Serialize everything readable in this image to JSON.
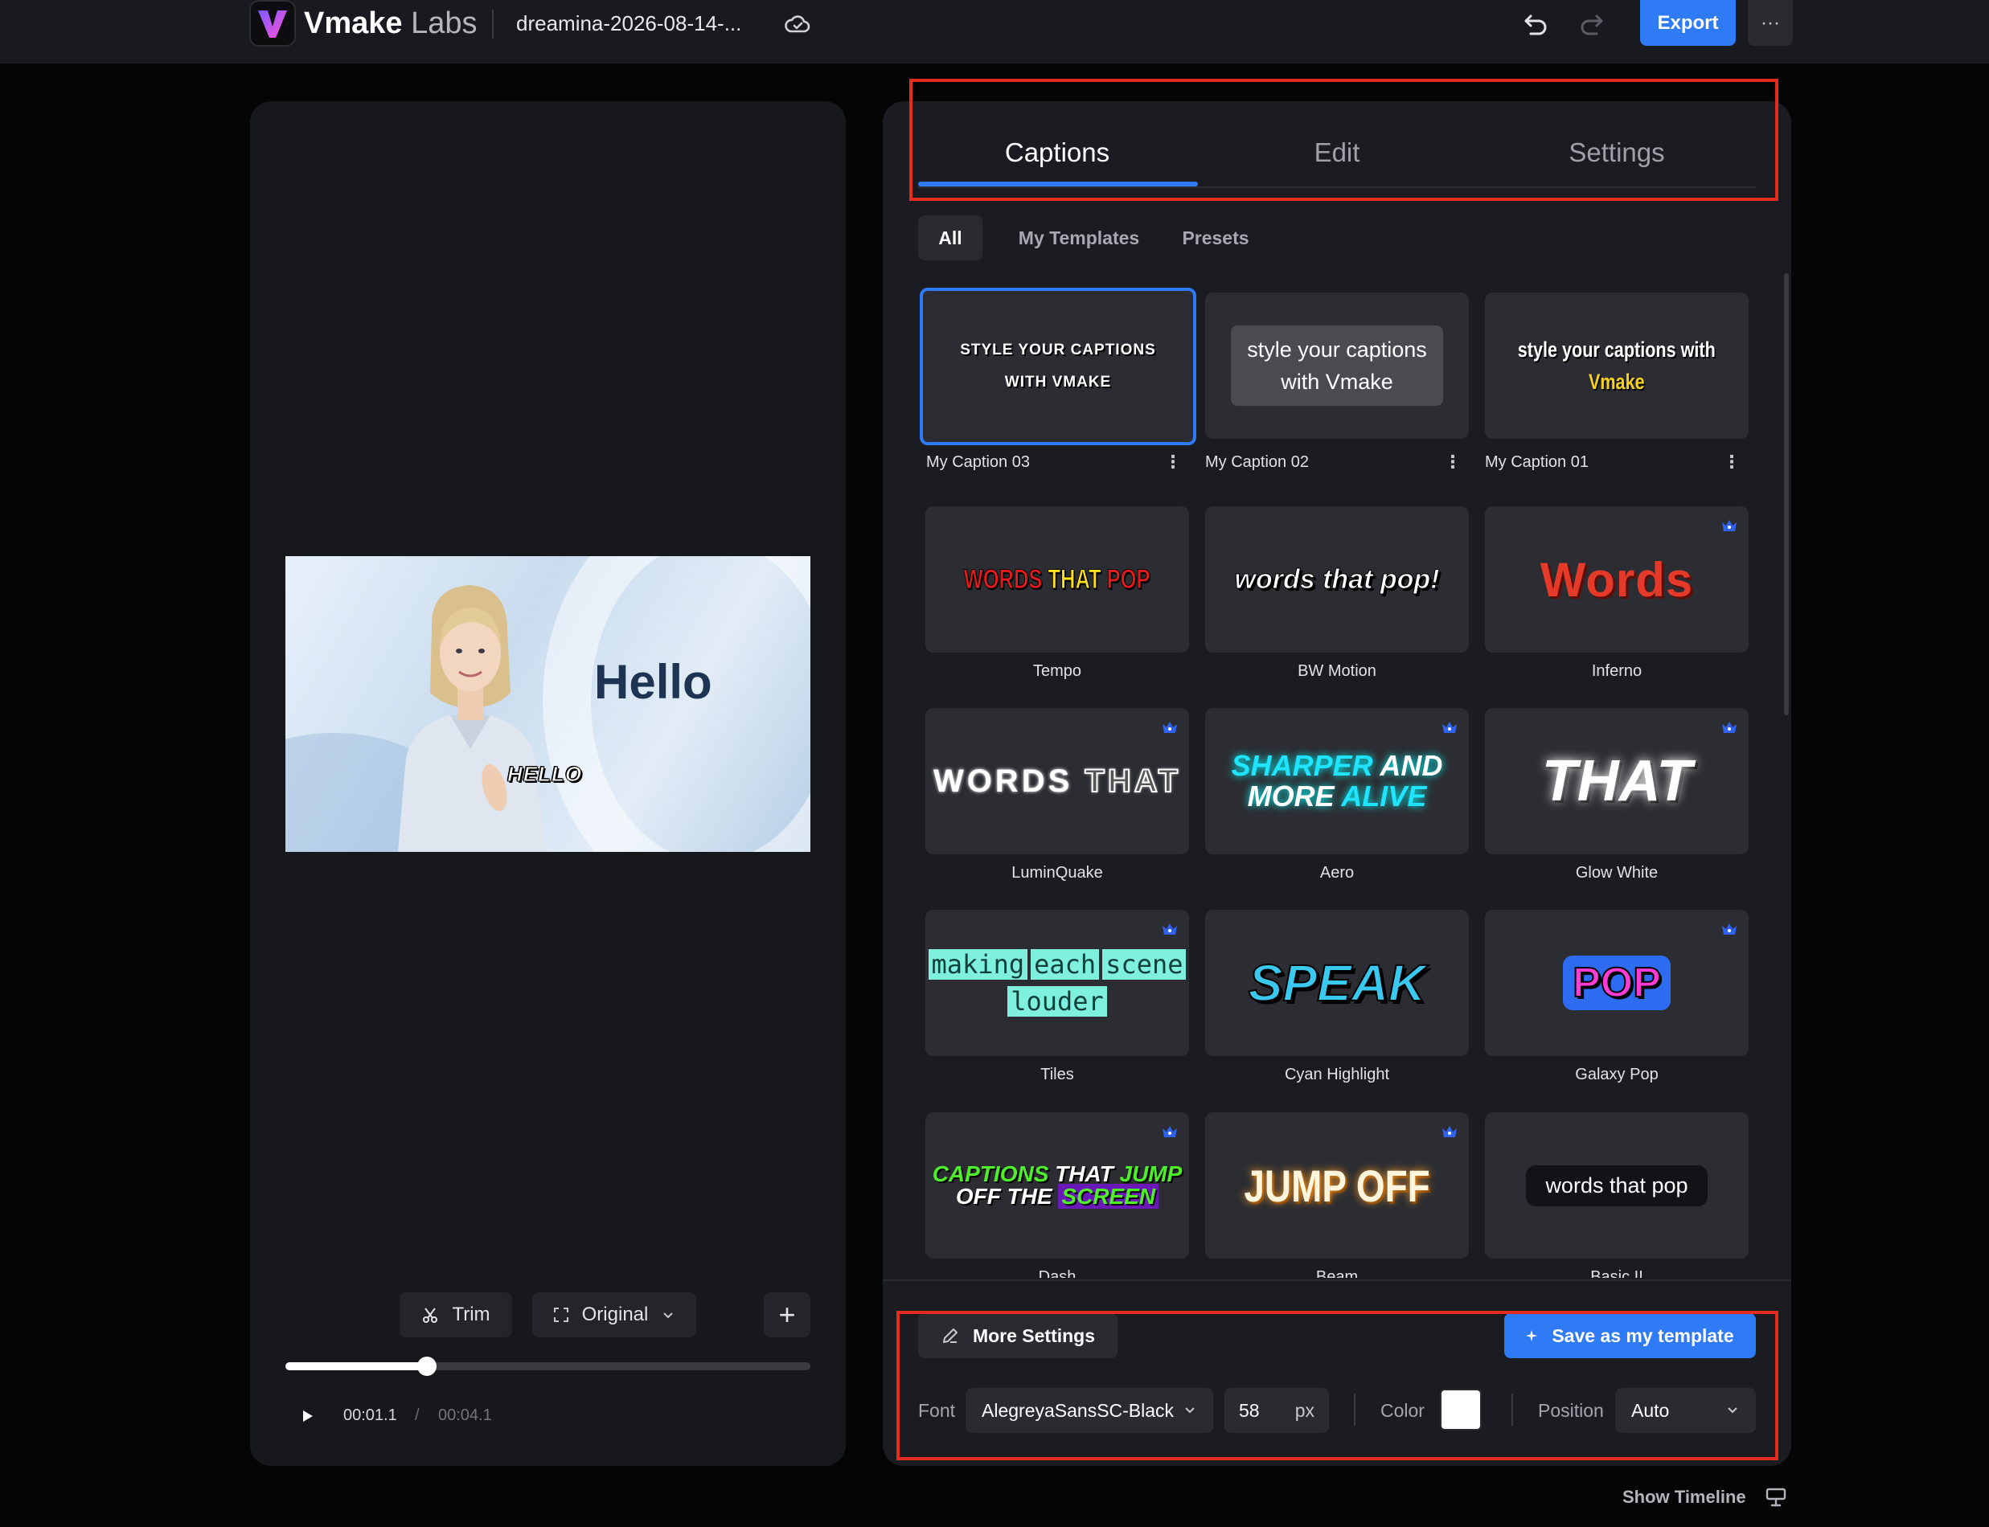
{
  "app": {
    "brand": "Vmake",
    "brand_suffix": "Labs",
    "project_name": "dreamina-2026-08-14-...",
    "export_label": "Export",
    "more_label": "···",
    "accent_color": "#2f7bf5"
  },
  "preview": {
    "video_title_text": "Hello",
    "video_caption_text": "HELLO",
    "trim_label": "Trim",
    "aspect_label": "Original",
    "add_label": "+",
    "time_current": "00:01.1",
    "time_separator": "/",
    "time_total": "00:04.1",
    "progress": 0.27
  },
  "tabs": [
    {
      "label": "Captions",
      "active": true
    },
    {
      "label": "Edit",
      "active": false
    },
    {
      "label": "Settings",
      "active": false
    }
  ],
  "subtabs": [
    {
      "label": "All",
      "active": true
    },
    {
      "label": "My Templates",
      "active": false
    },
    {
      "label": "Presets",
      "active": false
    }
  ],
  "templates": {
    "my_caption_03": {
      "label": "My Caption 03",
      "preview": [
        "STYLE YOUR CAPTIONS",
        "WITH VMAKE"
      ]
    },
    "my_caption_02": {
      "label": "My Caption 02",
      "preview": [
        "style your captions",
        "with Vmake"
      ]
    },
    "my_caption_01": {
      "label": "My Caption 01",
      "preview": [
        "style your captions with",
        "Vmake"
      ]
    },
    "tempo": {
      "label": "Tempo",
      "preview": [
        "WORDS",
        "THAT",
        "POP"
      ]
    },
    "bw_motion": {
      "label": "BW Motion",
      "preview": "words that pop!"
    },
    "inferno": {
      "label": "Inferno",
      "preview": "Words",
      "premium": true
    },
    "luminquake": {
      "label": "LuminQuake",
      "preview": [
        "WORDS",
        "THAT"
      ],
      "premium": true
    },
    "aero": {
      "label": "Aero",
      "preview": [
        "SHARPER",
        "AND",
        "MORE",
        "ALIVE"
      ],
      "premium": true
    },
    "glow_white": {
      "label": "Glow White",
      "preview": "THAT",
      "premium": true
    },
    "tiles": {
      "label": "Tiles",
      "preview": [
        "making",
        "each",
        "scene",
        "louder"
      ],
      "premium": true
    },
    "cyan_highlight": {
      "label": "Cyan Highlight",
      "preview": "SPEAK"
    },
    "galaxy_pop": {
      "label": "Galaxy Pop",
      "preview": "POP",
      "premium": true
    },
    "dash": {
      "label": "Dash",
      "preview": [
        "CAPTIONS",
        "THAT",
        "JUMP",
        "OFF THE",
        "SCREEN"
      ],
      "premium": true
    },
    "beam": {
      "label": "Beam",
      "preview": "JUMP OFF",
      "premium": true
    },
    "basic_ii": {
      "label": "Basic II",
      "preview": "words that pop"
    }
  },
  "selected_template": "My Caption 03",
  "bottom": {
    "more_settings_label": "More Settings",
    "save_template_label": "Save as my template",
    "font_label": "Font",
    "font_value": "AlegreyaSansSC-Black",
    "size_value": "58",
    "size_unit": "px",
    "color_label": "Color",
    "color_value": "#ffffff",
    "position_label": "Position",
    "position_value": "Auto"
  },
  "footer": {
    "show_timeline_label": "Show Timeline"
  }
}
